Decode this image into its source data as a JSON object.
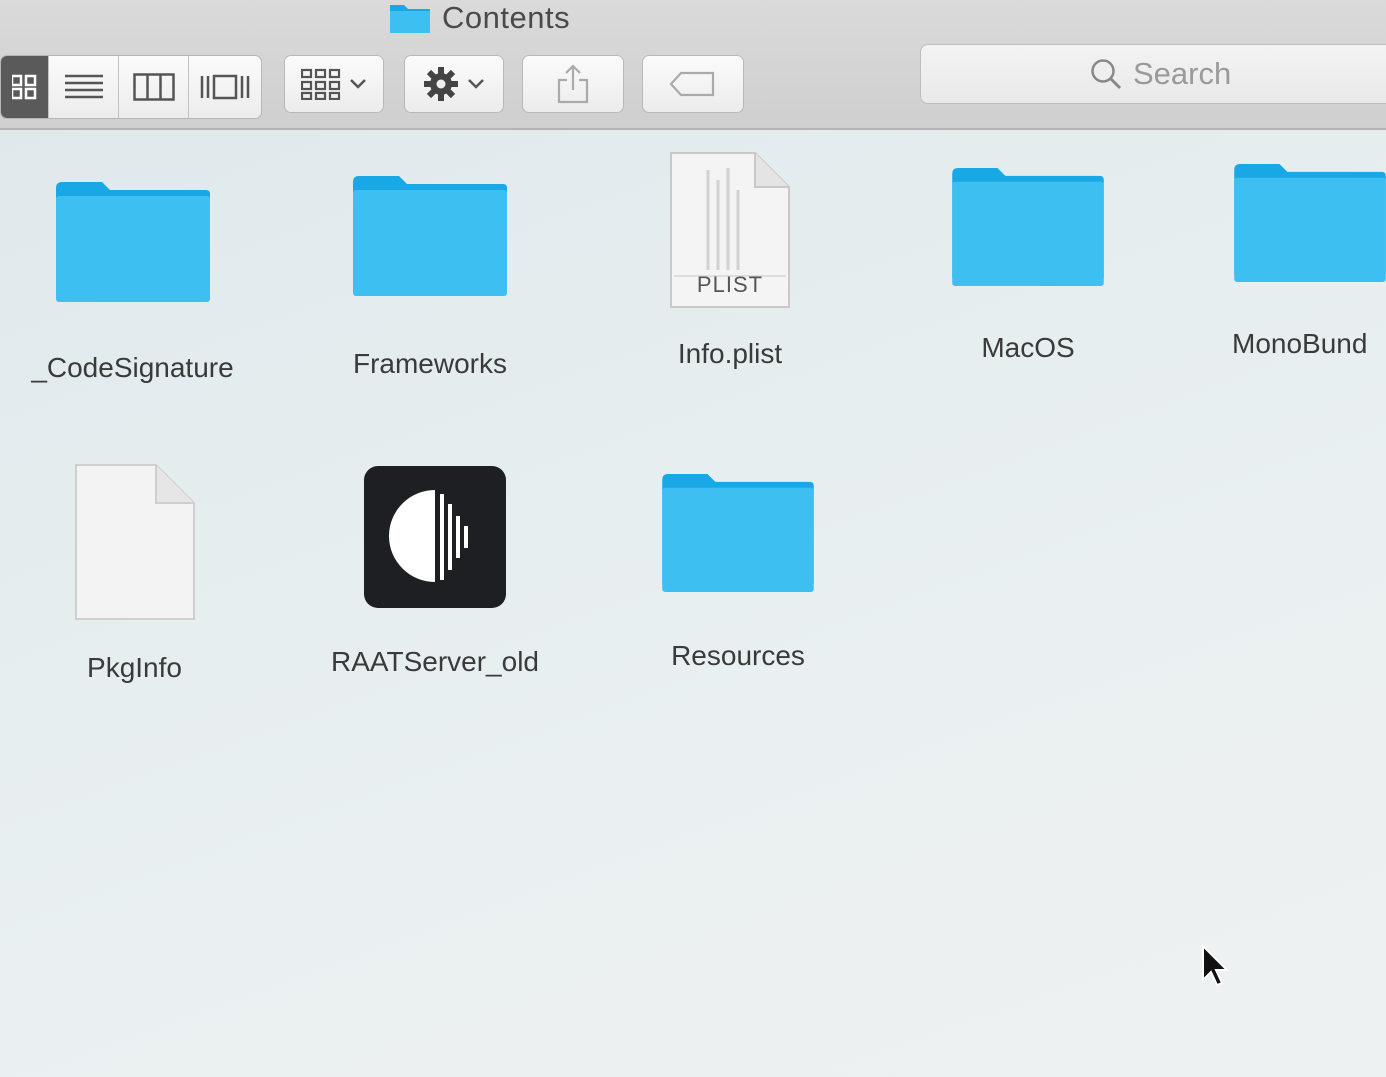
{
  "window": {
    "title": "Contents",
    "title_icon": "folder-icon"
  },
  "toolbar": {
    "view_modes": [
      {
        "name": "icon-view",
        "active": true
      },
      {
        "name": "list-view",
        "active": false
      },
      {
        "name": "column-view",
        "active": false
      },
      {
        "name": "cover-flow-view",
        "active": false
      }
    ],
    "arrange_icon": "arrange-grid-icon",
    "action_icon": "gear-icon",
    "share_icon": "share-icon",
    "tag_icon": "tag-icon",
    "search_placeholder": "Search"
  },
  "colors": {
    "folder_light": "#3dbff2",
    "folder_dark": "#19a8e6",
    "active_segment": "#5a5a5a"
  },
  "files": [
    {
      "name": "_CodeSignature",
      "kind": "folder"
    },
    {
      "name": "Frameworks",
      "kind": "folder"
    },
    {
      "name": "Info.plist",
      "kind": "plist",
      "badge": "PLIST"
    },
    {
      "name": "MacOS",
      "kind": "folder"
    },
    {
      "name": "MonoBund",
      "kind": "folder"
    },
    {
      "name": "PkgInfo",
      "kind": "document"
    },
    {
      "name": "RAATServer_old",
      "kind": "application"
    },
    {
      "name": "Resources",
      "kind": "folder"
    }
  ]
}
